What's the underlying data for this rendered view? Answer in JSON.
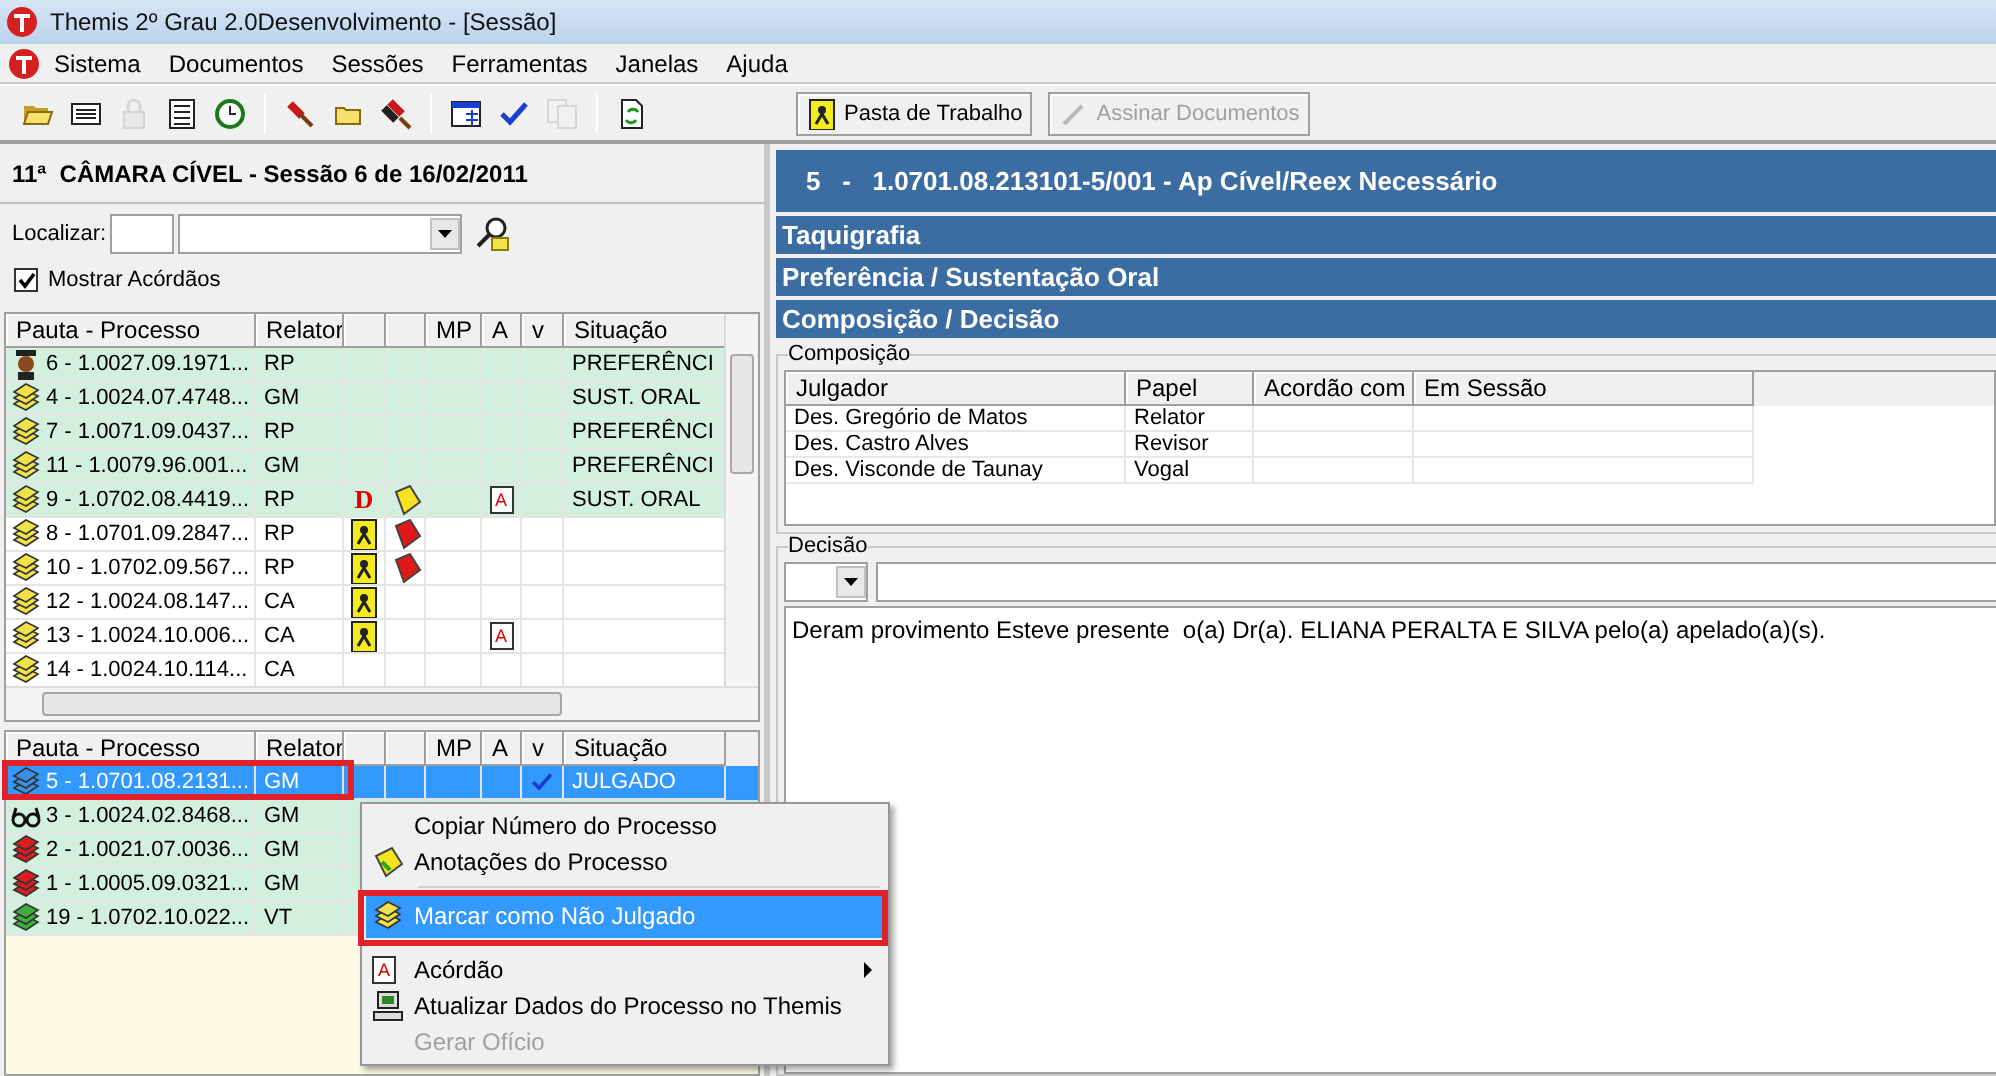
{
  "window": {
    "title": "Themis 2º Grau 2.0Desenvolvimento - [Sessão]"
  },
  "menu": [
    "Sistema",
    "Documentos",
    "Sessões",
    "Ferramentas",
    "Janelas",
    "Ajuda"
  ],
  "toolbar_groups": [
    [
      {
        "kind": "folder-open",
        "disabled": false
      },
      {
        "kind": "card",
        "disabled": false
      },
      {
        "kind": "lock",
        "disabled": true
      },
      {
        "kind": "list",
        "disabled": false
      },
      {
        "kind": "clock",
        "disabled": false
      }
    ],
    [
      {
        "kind": "gavel",
        "disabled": false
      },
      {
        "kind": "folder",
        "disabled": false
      },
      {
        "kind": "gavels",
        "disabled": false
      }
    ],
    [
      {
        "kind": "calendar",
        "disabled": false
      },
      {
        "kind": "check",
        "disabled": false
      },
      {
        "kind": "copy",
        "disabled": true
      }
    ],
    [
      {
        "kind": "refresh",
        "disabled": false
      }
    ]
  ],
  "actions": [
    {
      "label": "Pasta de Trabalho",
      "kind": "person-doc",
      "disabled": false
    },
    {
      "label": "Assinar Documentos",
      "kind": "pen",
      "disabled": true
    }
  ],
  "session": {
    "title": "11ª  CÂMARA CÍVEL - Sessão 6 de 16/02/2011"
  },
  "search": {
    "label": "Localizar:"
  },
  "show_acordaos": {
    "label": "Mostrar Acórdãos",
    "checked": true
  },
  "pauta_columns": [
    "Pauta - Processo",
    "Relator",
    null,
    null,
    "MP",
    "A",
    "v",
    "Situação"
  ],
  "pauta": [
    {
      "kind": "person",
      "process": "6 - 1.0027.09.1971...",
      "relator": "RP",
      "situacao": "PREFERÊNCI",
      "highlighted": true,
      "selected": false
    },
    {
      "kind": "books-yellow",
      "process": "4 - 1.0024.07.4748...",
      "relator": "GM",
      "situacao": "SUST. ORAL",
      "highlighted": true,
      "selected": false
    },
    {
      "kind": "books-yellow",
      "process": "7 - 1.0071.09.0437...",
      "relator": "RP",
      "situacao": "PREFERÊNCI",
      "highlighted": true,
      "selected": false
    },
    {
      "kind": "books-yellow",
      "process": "11 - 1.0079.96.001...",
      "relator": "GM",
      "situacao": "PREFERÊNCI",
      "highlighted": true,
      "selected": false
    },
    {
      "kind": "books-yellow",
      "process": "9 - 1.0702.08.4419...",
      "relator": "RP",
      "flag_1": {
        "kind": "letter",
        "text": "D"
      },
      "flag_2": {
        "kind": "note-yellow"
      },
      "a": "A",
      "situacao": "SUST. ORAL",
      "highlighted": true,
      "selected": false
    },
    {
      "kind": "books-yellow",
      "process": "8 - 1.0701.09.2847...",
      "relator": "RP",
      "flag_1": {
        "kind": "person-doc"
      },
      "flag_2": {
        "kind": "note-red"
      },
      "highlighted": false,
      "selected": false
    },
    {
      "kind": "books-yellow",
      "process": "10 - 1.0702.09.567...",
      "relator": "RP",
      "flag_1": {
        "kind": "person-doc"
      },
      "flag_2": {
        "kind": "note-red"
      },
      "highlighted": false,
      "selected": false
    },
    {
      "kind": "books-yellow",
      "process": "12 - 1.0024.08.147...",
      "relator": "CA",
      "flag_1": {
        "kind": "person-doc"
      },
      "highlighted": false,
      "selected": false
    },
    {
      "kind": "books-yellow",
      "process": "13 - 1.0024.10.006...",
      "relator": "CA",
      "flag_1": {
        "kind": "person-doc"
      },
      "a": "A",
      "highlighted": false,
      "selected": false
    },
    {
      "kind": "books-yellow",
      "process": "14 - 1.0024.10.114...",
      "relator": "CA",
      "highlighted": false,
      "selected": false
    }
  ],
  "julgados_columns": [
    "Pauta - Processo",
    "Relator",
    null,
    null,
    "MP",
    "A",
    "v",
    "Situação"
  ],
  "julgados": [
    {
      "kind": "books-blue",
      "process": "5 - 1.0701.08.2131...",
      "relator": "GM",
      "v": true,
      "situacao": "JULGADO",
      "highlighted": true,
      "selected": true
    },
    {
      "kind": "glasses",
      "process": "3 - 1.0024.02.8468...",
      "relator": "GM",
      "v": false,
      "highlighted": true,
      "selected": false
    },
    {
      "kind": "books-red",
      "process": "2 - 1.0021.07.0036...",
      "relator": "GM",
      "highlighted": true,
      "selected": false
    },
    {
      "kind": "books-red",
      "process": "1 - 1.0005.09.0321...",
      "relator": "GM",
      "highlighted": true,
      "selected": false
    },
    {
      "kind": "books-green",
      "process": "19 - 1.0702.10.022...",
      "relator": "VT",
      "highlighted": true,
      "selected": false
    }
  ],
  "annotation_frames": {
    "table-row": true,
    "menu-item": true
  },
  "context_menu": [
    [
      {
        "label": "Copiar Número do Processo",
        "kind": "plain",
        "selected": false,
        "disabled": false,
        "submenu": false
      },
      {
        "label": "Anotações do Processo",
        "kind": "note",
        "selected": false,
        "disabled": false,
        "submenu": false
      }
    ],
    [
      {
        "label": "Marcar como Não Julgado",
        "kind": "books",
        "selected": true,
        "disabled": false,
        "submenu": false
      }
    ],
    [
      {
        "label": "Acórdão",
        "kind": "doc",
        "icon_text": "A",
        "selected": false,
        "disabled": false,
        "submenu": true
      },
      {
        "label": "Atualizar Dados do Processo no Themis",
        "kind": "computer",
        "selected": false,
        "disabled": false,
        "submenu": false
      },
      {
        "label": "Gerar Ofício",
        "kind": "plain",
        "selected": false,
        "disabled": true,
        "submenu": false
      }
    ]
  ],
  "case_header": "5   -   1.0701.08.213101-5/001 - Ap Cível/Reex Necessário",
  "sections": [
    "Taquigrafia",
    "Preferência / Sustentação Oral",
    "Composição / Decisão"
  ],
  "composicao": {
    "legend": "Composição",
    "columns": [
      "Julgador",
      "Papel",
      "Acordão com",
      "Em Sessão"
    ],
    "rows": [
      {
        "julgador": "Des. Gregório de Matos",
        "papel": "Relator"
      },
      {
        "julgador": "Des. Castro Alves",
        "papel": "Revisor"
      },
      {
        "julgador": "Des. Visconde de Taunay",
        "papel": "Vogal"
      }
    ]
  },
  "decisao": {
    "legend": "Decisão",
    "text": "Deram provimento Esteve presente  o(a) Dr(a). ELIANA PERALTA E SILVA pelo(a) apelado(a)(s)."
  }
}
